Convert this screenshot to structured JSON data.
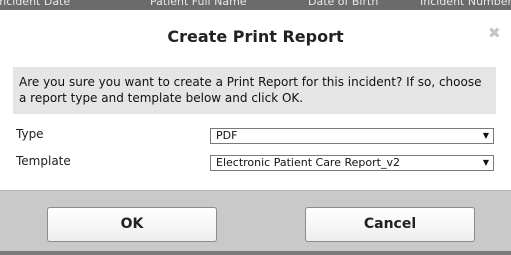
{
  "background_table": {
    "columns": [
      "Incident Date",
      "Patient Full Name",
      "Date of Birth",
      "Incident Number"
    ]
  },
  "dialog": {
    "title": "Create Print Report",
    "close_symbol": "✖",
    "message": "Are you sure you want to create a Print Report for this incident? If so, choose a report type and template below and click OK.",
    "fields": {
      "type": {
        "label": "Type",
        "value": "PDF"
      },
      "template": {
        "label": "Template",
        "value": "Electronic Patient Care Report_v2"
      }
    },
    "buttons": {
      "ok": "OK",
      "cancel": "Cancel"
    }
  },
  "icons": {
    "close": "close-icon",
    "dropdown": "chevron-down-icon"
  },
  "colors": {
    "overlay": "#6b6b6b",
    "message_bg": "#e5e5e5",
    "footer_bg": "#c9c9c9"
  }
}
